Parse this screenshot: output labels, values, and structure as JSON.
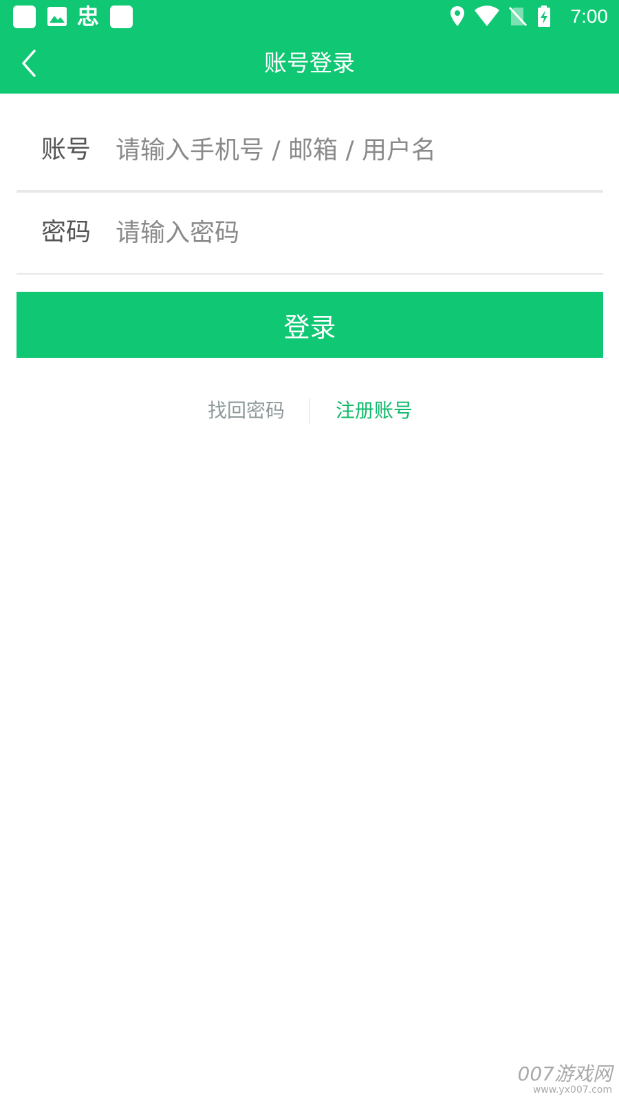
{
  "status_bar": {
    "time": "7:00",
    "app_icon_char": "忠",
    "icons": [
      "app-square",
      "image-icon",
      "app-square",
      "location-icon",
      "wifi-icon",
      "no-sim-icon",
      "battery-charging-icon"
    ]
  },
  "header": {
    "title": "账号登录",
    "back_icon": "chevron-left-icon"
  },
  "form": {
    "account_label": "账号",
    "account_placeholder": "请输入手机号 / 邮箱 / 用户名",
    "password_label": "密码",
    "password_placeholder": "请输入密码",
    "login_label": "登录"
  },
  "links": {
    "forgot_password": "找回密码",
    "register": "注册账号"
  },
  "watermark": {
    "main": "007游戏网",
    "sub": "www.yx007.com"
  },
  "colors": {
    "brand": "#10c774",
    "link": "#10b86a",
    "muted_link": "#8d9a99",
    "label": "#555555",
    "placeholder": "#8a8a8a"
  }
}
